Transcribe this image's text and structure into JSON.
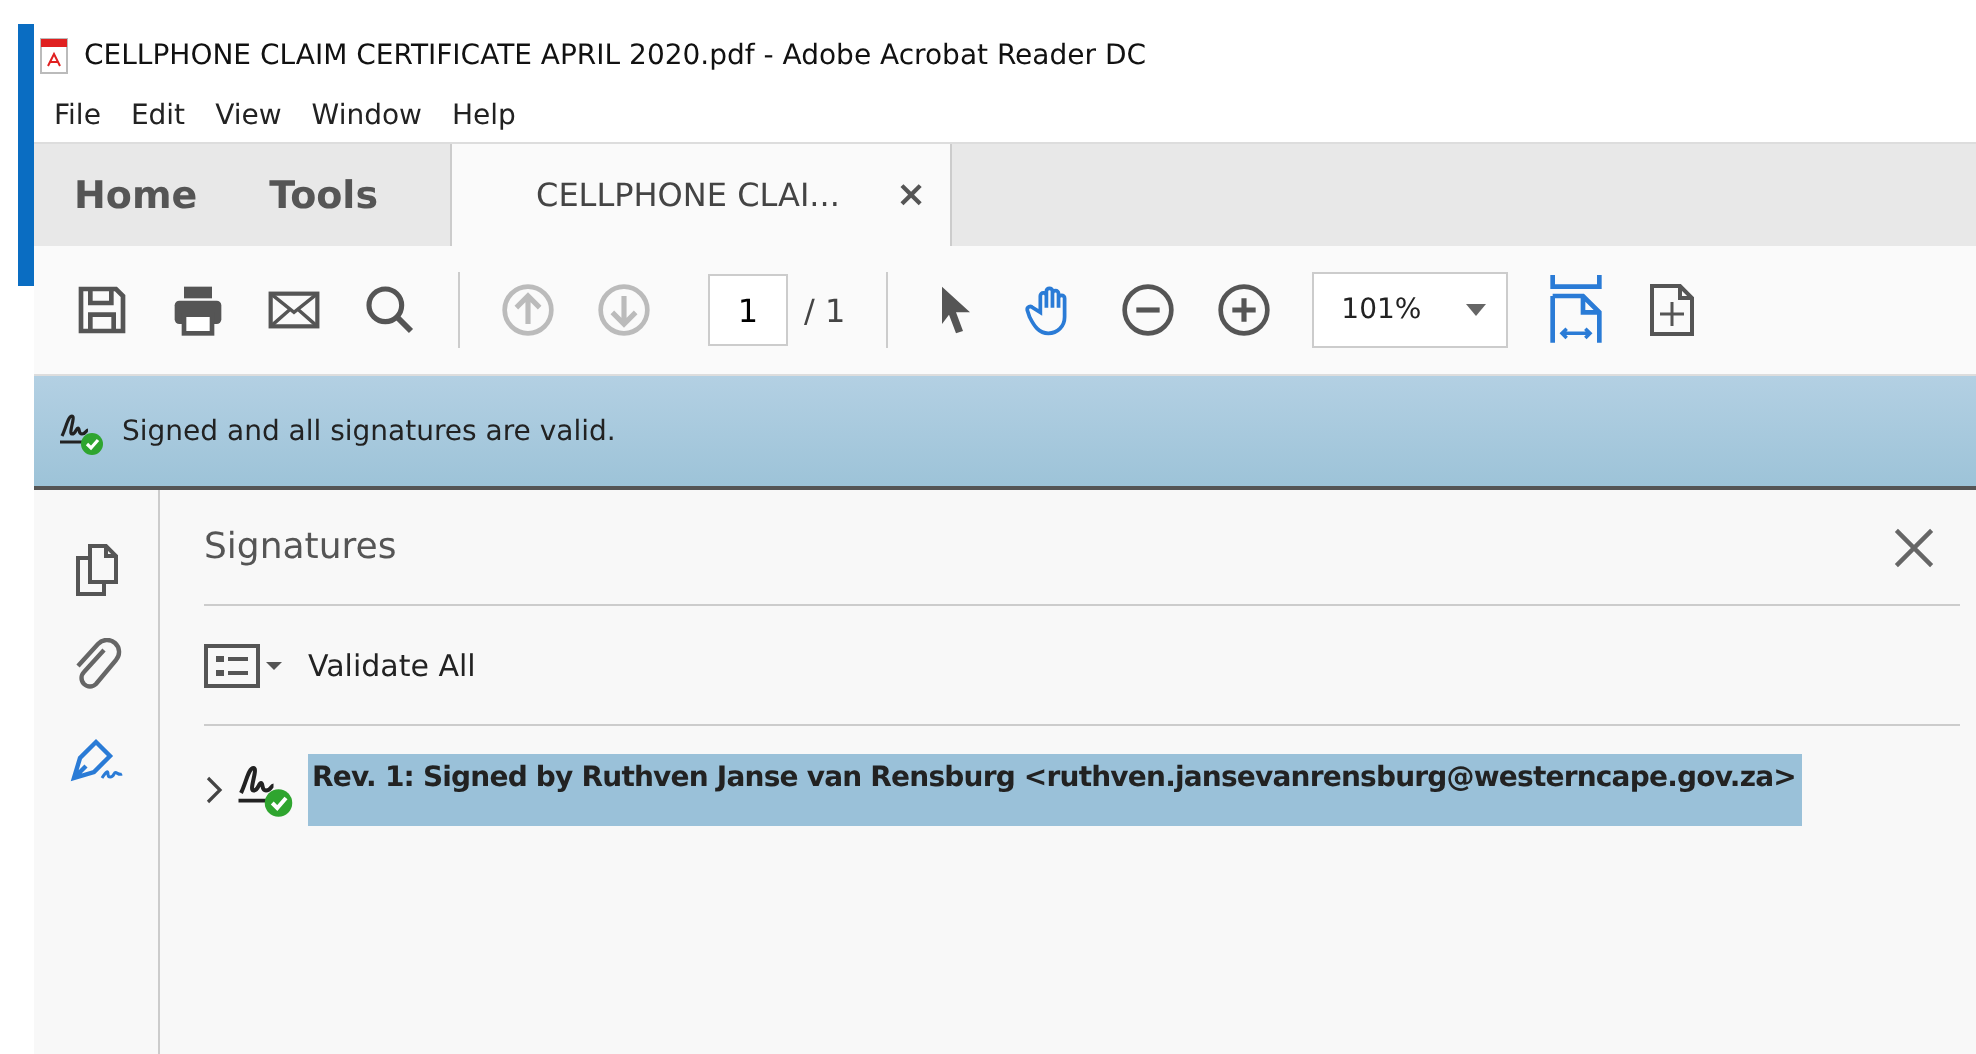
{
  "window": {
    "title": "CELLPHONE CLAIM CERTIFICATE APRIL 2020.pdf - Adobe Acrobat Reader DC"
  },
  "menu": [
    "File",
    "Edit",
    "View",
    "Window",
    "Help"
  ],
  "tabs": [
    {
      "label": "Home",
      "kind": "nav",
      "selected": false
    },
    {
      "label": "Tools",
      "kind": "nav",
      "selected": false
    },
    {
      "label": "CELLPHONE CLAI...",
      "kind": "document",
      "selected": true,
      "close": "×"
    }
  ],
  "toolbar": {
    "page": "1",
    "page_total": "/ 1",
    "zoom": "101%"
  },
  "banner": {
    "text": "Signed and all signatures are valid."
  },
  "panel": {
    "title": "Signatures",
    "validate_label": "Validate All",
    "signatures": [
      {
        "text": "Rev. 1: Signed by Ruthven Janse van Rensburg <ruthven.jansevanrensburg@westerncape.gov.za>",
        "expanded": false,
        "selected": true,
        "valid": true
      }
    ]
  }
}
